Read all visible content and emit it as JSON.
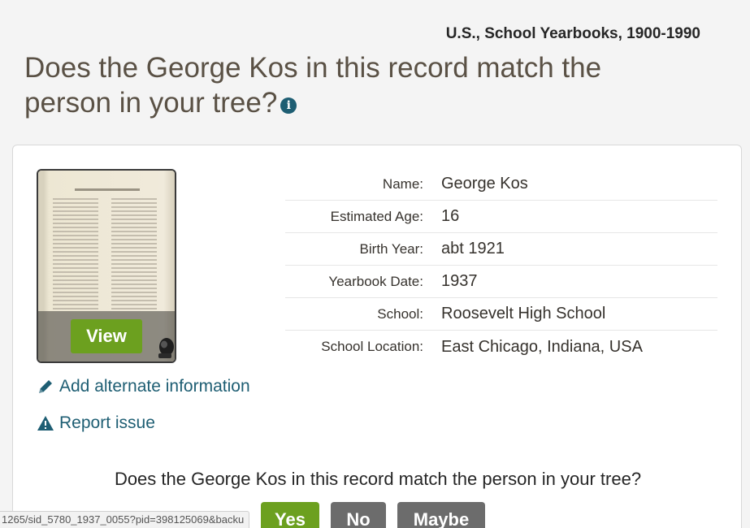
{
  "collection": {
    "title": "U.S., School Yearbooks, 1900-1990"
  },
  "header": {
    "question": "Does the George Kos in this record match the person in your tree?",
    "info_icon": "info-icon"
  },
  "thumbnail": {
    "view_label": "View",
    "icon": "camera-icon"
  },
  "actions": {
    "add_alternate": "Add alternate information",
    "report_issue": "Report issue"
  },
  "record": {
    "fields": [
      {
        "label": "Name:",
        "value": "George Kos"
      },
      {
        "label": "Estimated Age:",
        "value": "16"
      },
      {
        "label": "Birth Year:",
        "value": "abt 1921"
      },
      {
        "label": "Yearbook Date:",
        "value": "1937"
      },
      {
        "label": "School:",
        "value": "Roosevelt High School"
      },
      {
        "label": "School Location:",
        "value": "East Chicago, Indiana, USA"
      }
    ]
  },
  "match": {
    "question": "Does the George Kos in this record match the person in your tree?",
    "yes_label": "Yes",
    "no_label": "No",
    "maybe_label": "Maybe"
  },
  "status_bar": {
    "url": "1265/sid_5780_1937_0055?pid=398125069&backu"
  },
  "colors": {
    "accent_green": "#6ca01f",
    "link_blue": "#1e5e73",
    "neutral_button": "#6c6c6c"
  }
}
